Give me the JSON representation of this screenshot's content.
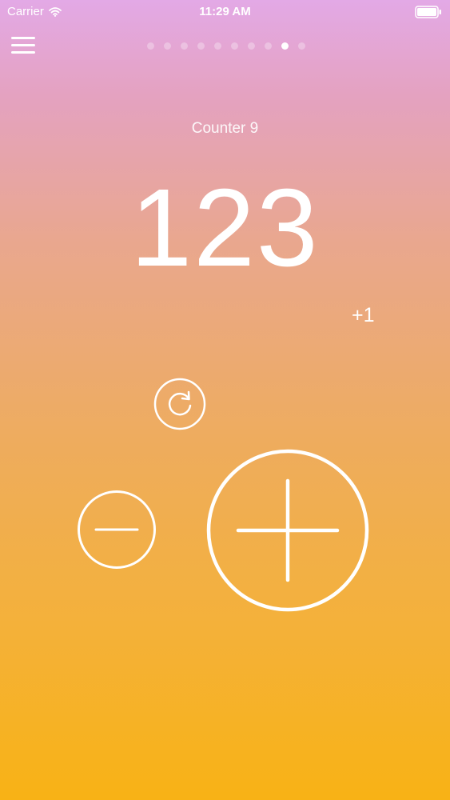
{
  "status_bar": {
    "carrier": "Carrier",
    "time": "11:29 AM",
    "wifi_icon": "wifi-icon",
    "battery_icon": "battery-icon"
  },
  "nav": {
    "menu_icon": "hamburger-menu-icon",
    "page_count": 10,
    "active_page": 9
  },
  "counter": {
    "title": "Counter 9",
    "value": "123",
    "step_label": "+1"
  },
  "controls": {
    "reset_icon": "refresh-icon",
    "decrement_icon": "minus-icon",
    "increment_icon": "plus-icon"
  },
  "colors": {
    "gradient_top": "#e3a9e6",
    "gradient_bottom": "#f8b215",
    "foreground": "#ffffff"
  }
}
